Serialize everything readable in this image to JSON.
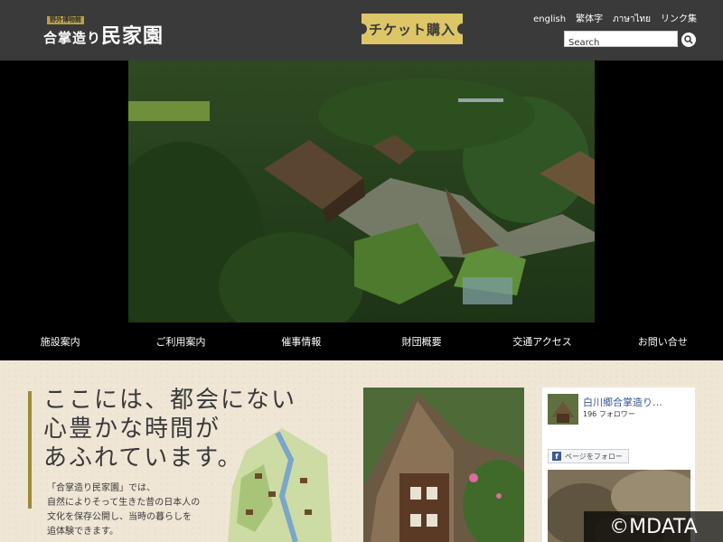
{
  "header": {
    "logo_badge": "野外博物館",
    "logo_small": "合掌造り",
    "logo_main": "民家園",
    "ticket_label": "チケット購入",
    "languages": [
      "english",
      "繁体字",
      "ภาษาไทย",
      "リンク集"
    ],
    "search_placeholder": "Search"
  },
  "nav": {
    "items": [
      "施設案内",
      "ご利用案内",
      "催事情報",
      "財団概要",
      "交通アクセス",
      "お問い合せ"
    ]
  },
  "content": {
    "headline": [
      "ここには、都会にない",
      "心豊かな時間が",
      "あふれています。"
    ],
    "body": [
      "「合掌造り民家園」では、",
      "自然によりそって生きた昔の日本人の",
      "文化を保存公開し、当時の暮らしを",
      "追体験できます。"
    ]
  },
  "facebook": {
    "page_name": "白川郷合掌造り…",
    "followers": "196 フォロワー",
    "follow_label": "ページをフォロー"
  },
  "watermark": "©MDATA",
  "colors": {
    "header_bg": "#3a3a3a",
    "ticket_gold": "#ddc667",
    "accent_gold": "#9c8a3a",
    "content_bg": "#efe6d6",
    "fb_link": "#365899"
  }
}
